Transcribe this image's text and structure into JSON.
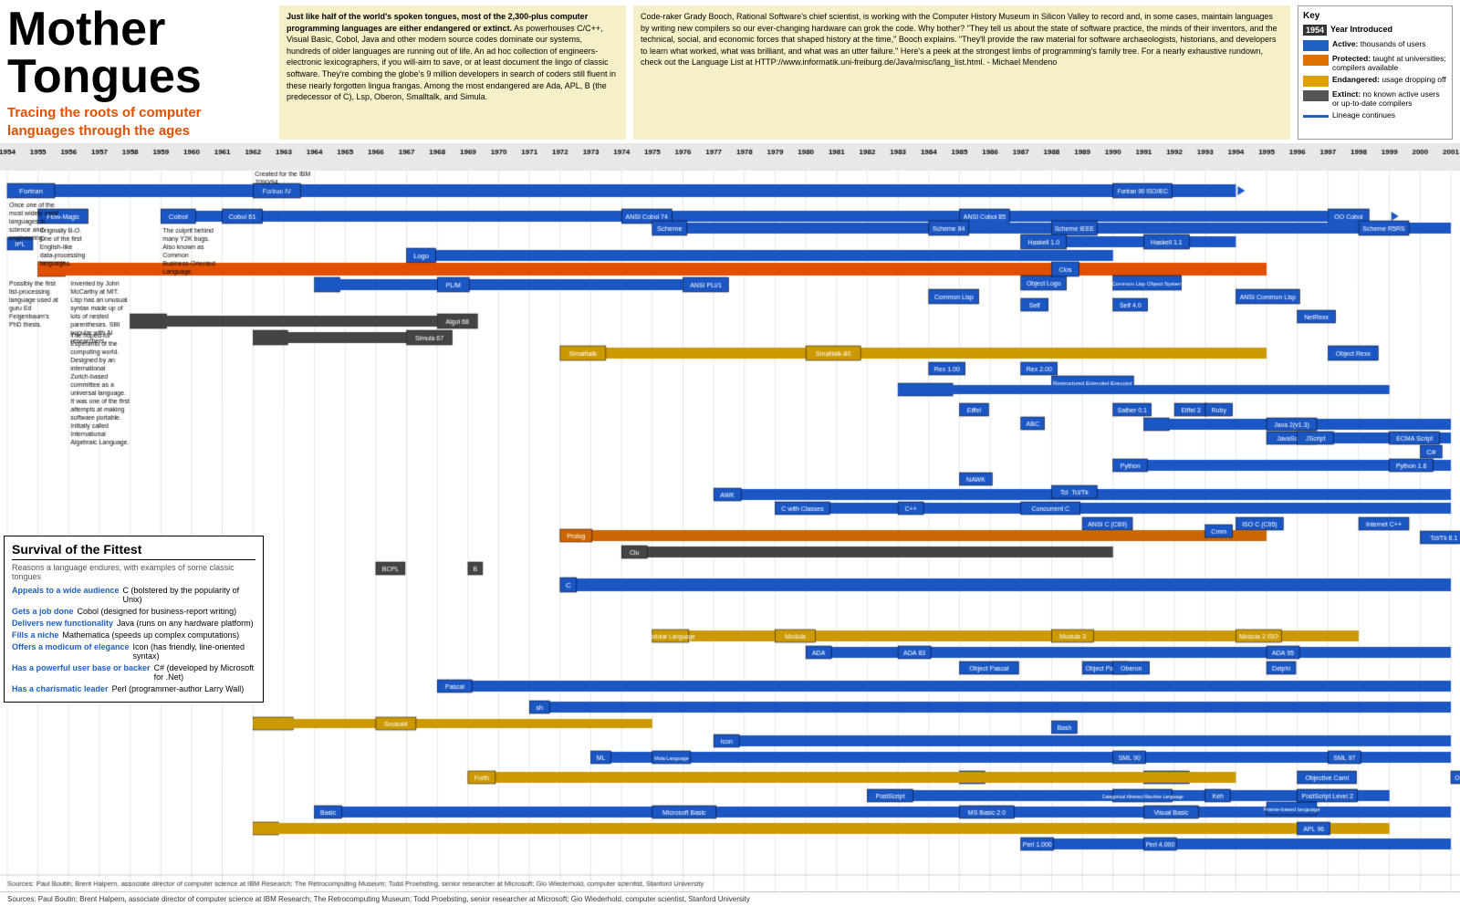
{
  "header": {
    "main_title": "Mother\nTongues",
    "subtitle": "Tracing the roots of computer\nlanguages through the ages",
    "text_left_bold": "Just like half of the world's spoken tongues, most of the 2,300-plus computer programming languages are either endangered or extinct.",
    "text_left": " As powerhouses C/C++, Visual Basic, Cobol, Java and other modern source codes dominate our systems, hundreds of older languages are running out of life.\n\nAn ad hoc collection of engineers-electronic lexicographers, if you will-aim to save, or at least document the lingo of classic software. They're combing the globe's 9 million developers in search of coders still fluent in these nearly forgotten lingua frangas. Among the most endangered are Ada, APL, B (the predecessor of C), Lsp, Oberon, Smalltalk, and Simula.",
    "text_right": "Code-raker Grady Booch, Rational Software's chief scientist, is working with the Computer History Museum in Silicon Valley to record and, in some cases, maintain languages by writing new compilers so our ever-changing hardware can grok the code. Why bother? \"They tell us about the state of software practice, the minds of their inventors, and the technical, social, and economic forces that shaped history at the time,\" Booch explains. \"They'll provide the raw material for software archaeologists, historians, and developers to learn what worked, what was brilliant, and what was an utter failure.\" Here's a peek at the strongest limbs of programming's family tree. For a nearly exhaustive rundown, check out the Language List at HTTP://www.informatik.uni-freiburg.de/Java/misc/lang_list.html. - Michael Mendeno"
  },
  "key": {
    "title": "Key",
    "year_label": "1954",
    "year_desc": "Year Introduced",
    "active_label": "Active:",
    "active_desc": "thousands of users",
    "protected_label": "Protected:",
    "protected_desc": "taught at universities; compilers available",
    "endangered_label": "Endangered:",
    "endangered_desc": "usage dropping off",
    "extinct_label": "Extinct:",
    "extinct_desc": "no known active users or up-to-date compilers",
    "lineage_label": "Lineage continues"
  },
  "survival": {
    "title": "Survival of the Fittest",
    "subtitle": "Reasons a language endures, with examples of some classic tongues",
    "rows": [
      {
        "label": "Appeals to a wide audience",
        "value": "C (bolstered by the popularity of Unix)"
      },
      {
        "label": "Gets a job done",
        "value": "Cobol (designed for business-report writing)"
      },
      {
        "label": "Delivers new functionality",
        "value": "Java (runs on any hardware platform)"
      },
      {
        "label": "Fills a niche",
        "value": "Mathematica (speeds up complex computations)"
      },
      {
        "label": "Offers a modicum of elegance",
        "value": "Icon (has friendly, line-oriented syntax)"
      },
      {
        "label": "Has a powerful user base or backer",
        "value": "C# (developed by Microsoft for .Net)"
      },
      {
        "label": "Has a charismatic leader",
        "value": "Perl (programmer-author Larry Wall)"
      }
    ]
  },
  "footer": "Sources: Paul Boutin; Brent Halpern, associate director of computer science at IBM Research; The Retrocomputing Museum; Todd Proebsting, senior researcher at Microsoft; Gio Wiederhold, computer scientist, Stanford University"
}
